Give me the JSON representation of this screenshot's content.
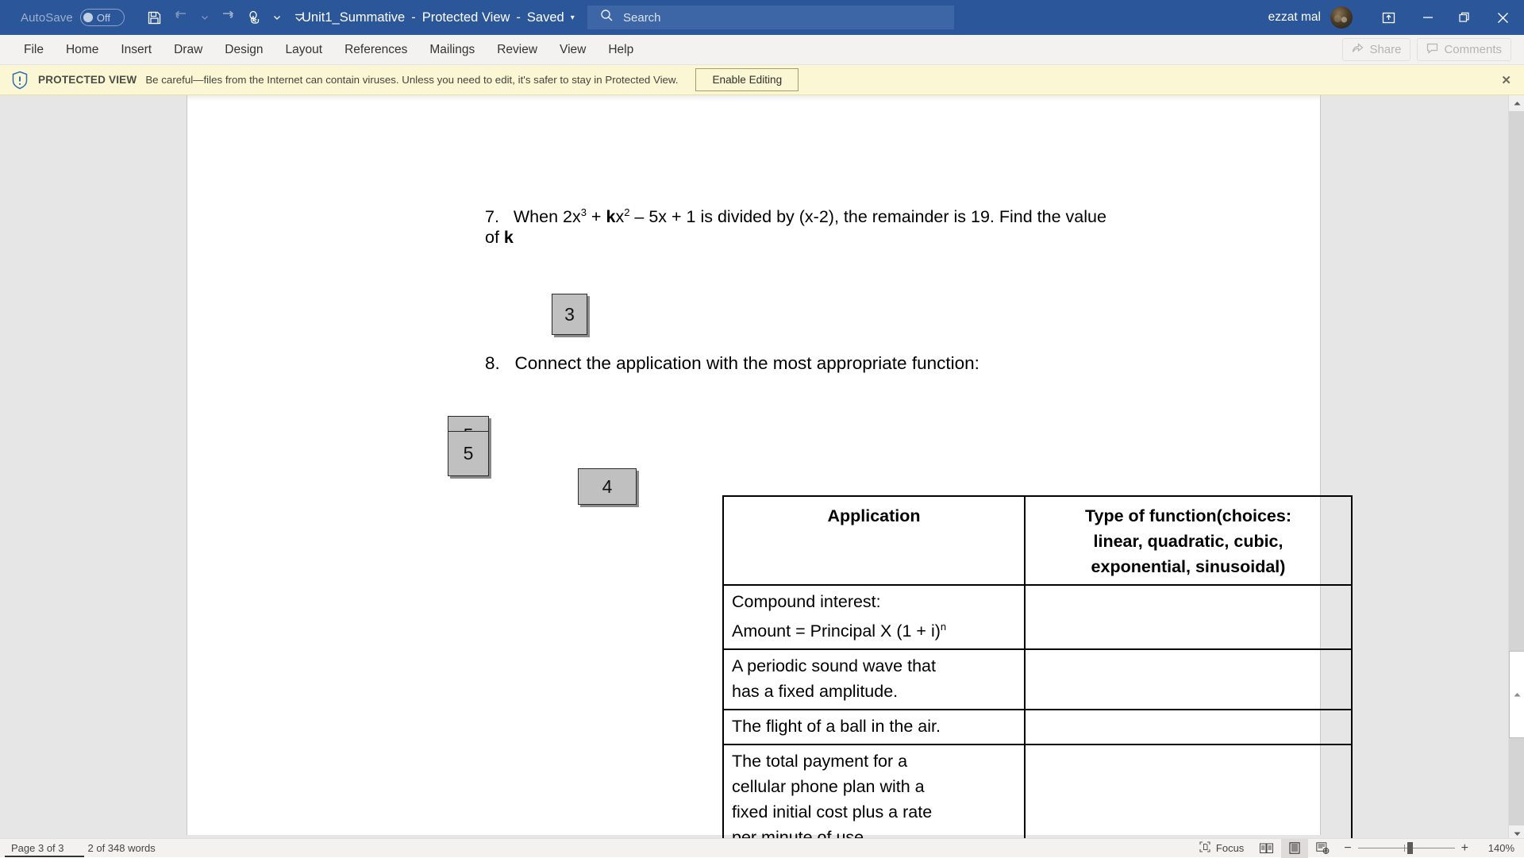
{
  "titlebar": {
    "autosave_label": "AutoSave",
    "autosave_state": "Off",
    "save_icon": "save-icon",
    "undo_icon": "undo-icon",
    "redo_icon": "redo-icon",
    "touch_mode_icon": "touch-mouse-mode-icon",
    "qat_more_icon": "customize-quick-access-toolbar-icon",
    "document_name": "Unit1_Summative",
    "separator1": "-",
    "protected_view_label": "Protected View",
    "separator2": "-",
    "saved_label": "Saved",
    "title_caret": "▾",
    "search_icon": "search-icon",
    "search_placeholder": "Search",
    "user_name": "ezzat mal",
    "avatar": "user-avatar",
    "ribbon_display_icon": "ribbon-display-options-icon",
    "minimize_icon": "minimize-icon",
    "restore_icon": "restore-icon",
    "close_icon": "close-icon",
    "accent_color": "#2b579a"
  },
  "ribbon": {
    "tabs": [
      {
        "label": "File"
      },
      {
        "label": "Home"
      },
      {
        "label": "Insert"
      },
      {
        "label": "Draw"
      },
      {
        "label": "Design"
      },
      {
        "label": "Layout"
      },
      {
        "label": "References"
      },
      {
        "label": "Mailings"
      },
      {
        "label": "Review"
      },
      {
        "label": "View"
      },
      {
        "label": "Help"
      }
    ],
    "share_label": "Share",
    "share_icon": "share-icon",
    "comments_label": "Comments",
    "comments_icon": "comments-icon"
  },
  "protected_view": {
    "shield_icon": "shield-icon",
    "title": "PROTECTED VIEW",
    "message": "Be careful—files from the Internet can contain viruses. Unless you need to edit, it's safer to stay in Protected View.",
    "enable_button": "Enable Editing",
    "close_icon": "close-banner-icon",
    "background_color": "#fbf6d3"
  },
  "document": {
    "question7": {
      "number": "7.",
      "text_part1": "When 2x",
      "sup1": "3",
      "text_part2": " + ",
      "bold_k1": "k",
      "text_part3": "x",
      "sup2": "2",
      "text_part4": " – 5x + 1 is divided by (x-2), the remainder is 19.  Find the value of ",
      "bold_k2": "k"
    },
    "question8": {
      "number": "8.",
      "text": "Connect the application with the most appropriate function:"
    },
    "placeholder_boxes": [
      {
        "label": "3",
        "name": "image-placeholder-3"
      },
      {
        "label": "5",
        "name": "image-placeholder-5-back"
      },
      {
        "label": "5",
        "name": "image-placeholder-5-front"
      },
      {
        "label": "4",
        "name": "image-placeholder-4"
      }
    ],
    "table": {
      "headers": [
        "Application",
        "Type of function(choices: linear, quadratic, cubic, exponential, sinusoidal)"
      ],
      "header_col2_lines": [
        "Type of function(choices:",
        "linear, quadratic, cubic,",
        "exponential, sinusoidal)"
      ],
      "rows": [
        {
          "application_lines": [
            "Compound interest:",
            "Amount = Principal X (1 + i)"
          ],
          "superscript": "n",
          "answer": ""
        },
        {
          "application_lines": [
            "A periodic sound wave that",
            "has a fixed amplitude."
          ],
          "superscript": "",
          "answer": ""
        },
        {
          "application_lines": [
            "The flight of a ball in the air."
          ],
          "superscript": "",
          "answer": ""
        },
        {
          "application_lines": [
            "The total payment for a",
            "cellular phone plan with a",
            "fixed initial cost plus a rate",
            "per minute of use."
          ],
          "superscript": "",
          "answer": ""
        }
      ]
    }
  },
  "statusbar": {
    "page_indicator": "Page 3 of 3",
    "word_count": "2 of 348 words",
    "focus_label": "Focus",
    "focus_icon": "focus-mode-icon",
    "read_mode_icon": "read-mode-icon",
    "print_layout_icon": "print-layout-icon",
    "web_layout_icon": "web-layout-icon",
    "zoom_out": "−",
    "zoom_in": "+",
    "zoom_level": "140%"
  },
  "scrollbar": {
    "up_arrow": "scroll-up-arrow",
    "down_arrow": "scroll-down-arrow",
    "thumb": "scroll-thumb"
  }
}
